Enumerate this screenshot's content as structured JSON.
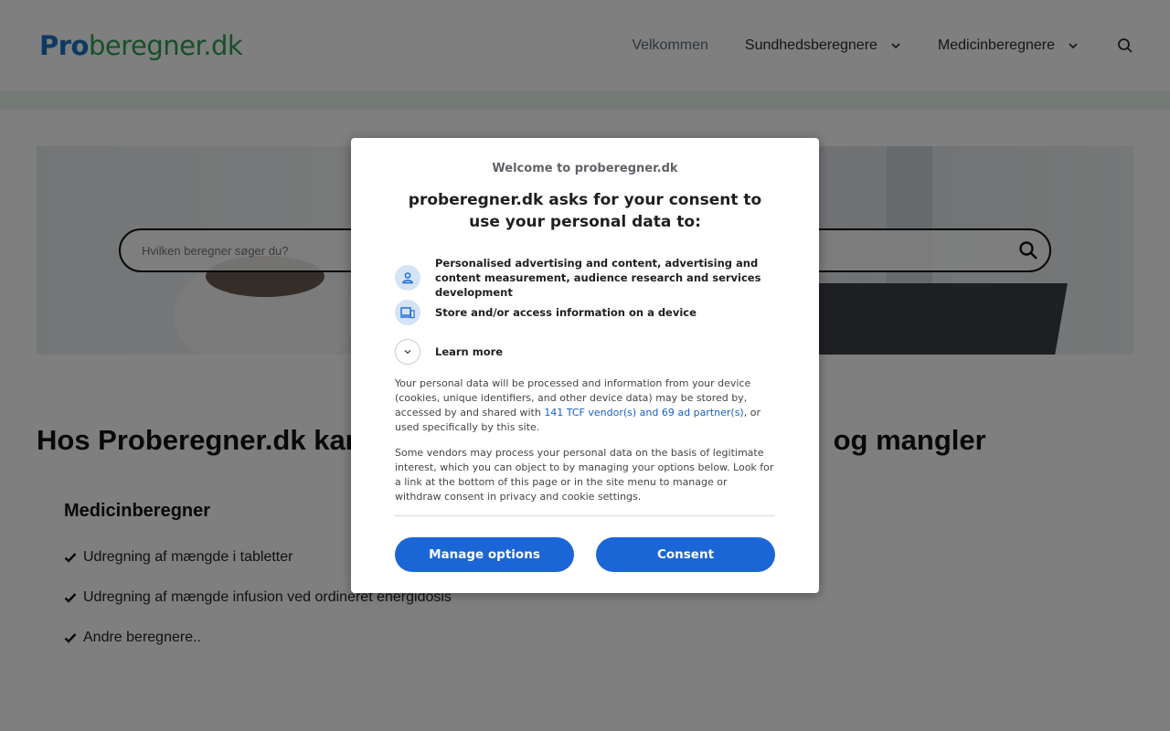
{
  "header": {
    "logo_pro": "Pro",
    "logo_rest": "beregner.dk",
    "nav": [
      {
        "label": "Velkommen"
      },
      {
        "label": "Sundhedsberegnere"
      },
      {
        "label": "Medicinberegnere"
      }
    ],
    "search_icon": "search-icon"
  },
  "hero": {
    "search_placeholder": "Hvilken beregner søger du?",
    "search_icon": "search-icon"
  },
  "content": {
    "title": "Hos Proberegner.dk kan",
    "title_end": "og mangler",
    "section_title": "Medicinberegner",
    "features": [
      "Udregning af mængde i tabletter",
      "Udregning af mængde infusion ved ordineret energidosis",
      "Andre beregnere.."
    ]
  },
  "consent": {
    "welcome": "Welcome to proberegner.dk",
    "title": "proberegner.dk asks for your consent to use your personal data to:",
    "purposes": [
      {
        "icon": "person-icon",
        "text": "Personalised advertising and content, advertising and content measurement, audience research and services development"
      },
      {
        "icon": "devices-icon",
        "text": "Store and/or access information on a device"
      }
    ],
    "learn_more": "Learn more",
    "paragraph1_start": "Your personal data will be processed and information from your device (cookies, unique identifiers, and other device data) may be stored by, accessed by and shared with ",
    "paragraph1_link": "141 TCF vendor(s) and 69 ad partner(s)",
    "paragraph1_end": ", or used specifically by this site.",
    "paragraph2": "Some vendors may process your personal data on the basis of legitimate interest, which you can object to by managing your options below. Look for a link at the bottom of this page or in the site menu to manage or withdraw consent in privacy and cookie settings.",
    "manage_button": "Manage options",
    "consent_button": "Consent"
  },
  "colors": {
    "brand_blue": "#1a73c4",
    "brand_green": "#2e9e52",
    "button_blue": "#1a66d6"
  }
}
